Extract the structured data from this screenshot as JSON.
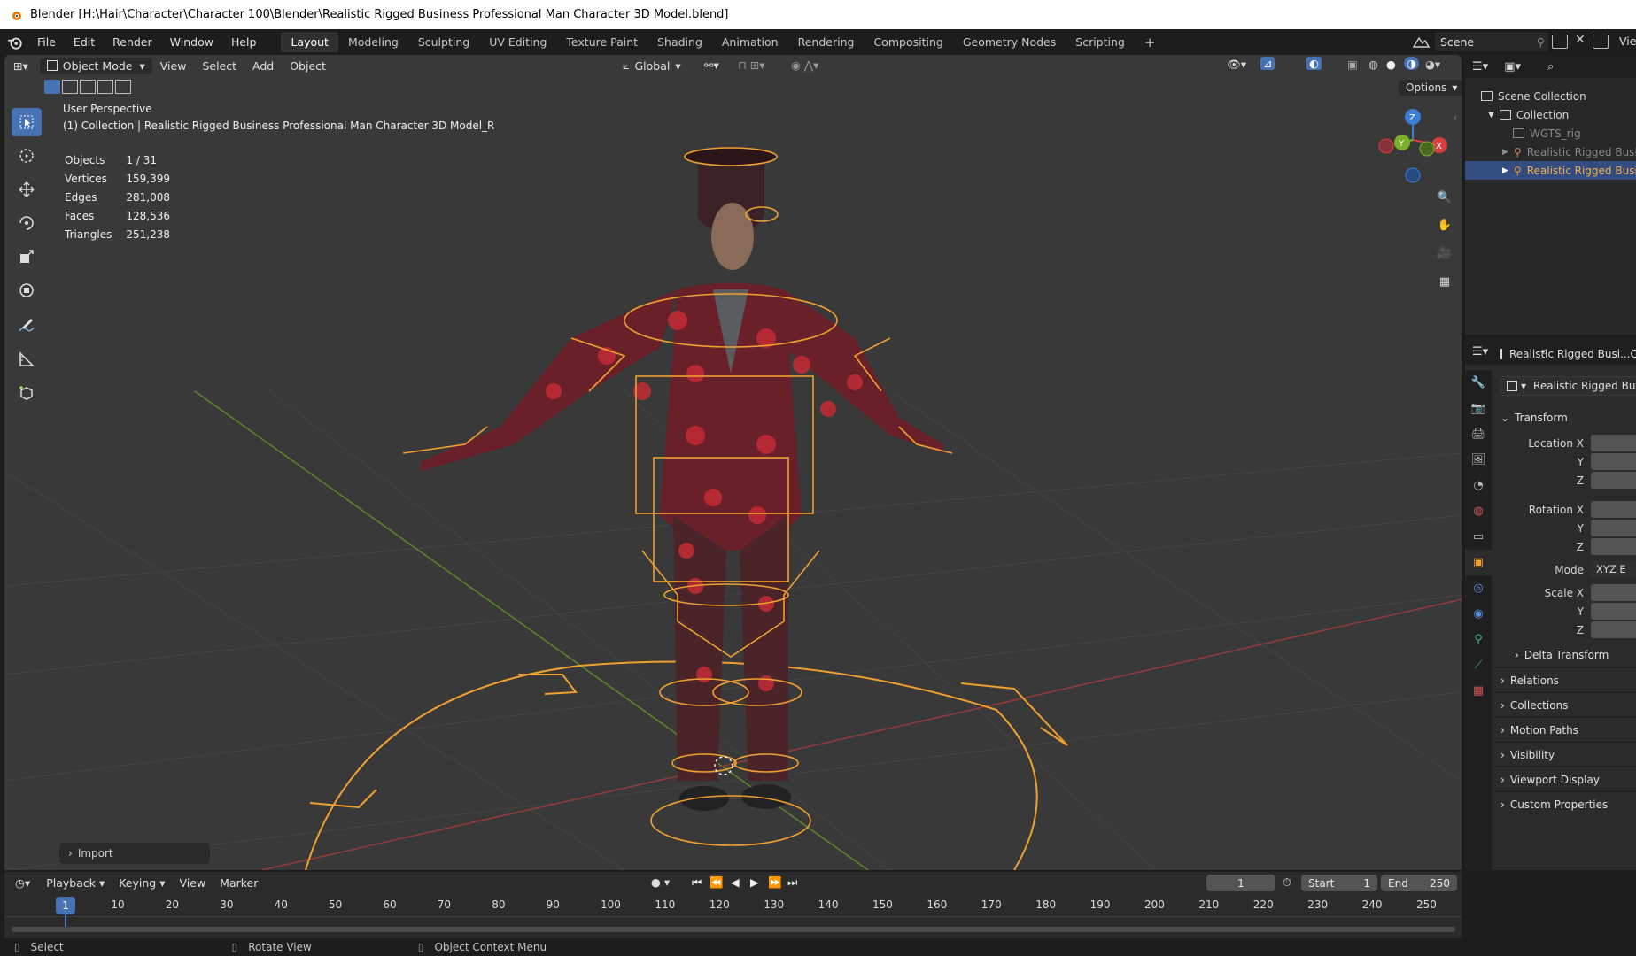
{
  "window": {
    "title": "Blender [H:\\Hair\\Character\\Character 100\\Blender\\Realistic Rigged Business Professional Man Character 3D Model.blend]"
  },
  "menu": [
    "File",
    "Edit",
    "Render",
    "Window",
    "Help"
  ],
  "workspaces": [
    "Layout",
    "Modeling",
    "Sculpting",
    "UV Editing",
    "Texture Paint",
    "Shading",
    "Animation",
    "Rendering",
    "Compositing",
    "Geometry Nodes",
    "Scripting"
  ],
  "active_workspace": "Layout",
  "scene": {
    "name": "Scene",
    "view_layer": "Vie"
  },
  "viewport": {
    "mode": "Object Mode",
    "header_menu": [
      "View",
      "Select",
      "Add",
      "Object"
    ],
    "orientation": "Global",
    "options_label": "Options",
    "perspective": "User Perspective",
    "collection_info": "(1) Collection | Realistic Rigged Business Professional Man Character 3D Model_R",
    "stats": [
      {
        "label": "Objects",
        "value": "1 / 31"
      },
      {
        "label": "Vertices",
        "value": "159,399"
      },
      {
        "label": "Edges",
        "value": "281,008"
      },
      {
        "label": "Faces",
        "value": "128,536"
      },
      {
        "label": "Triangles",
        "value": "251,238"
      }
    ],
    "gizmo": {
      "x": "X",
      "y": "Y",
      "z": "Z"
    },
    "last_operator": "Import"
  },
  "outliner": {
    "rows": [
      {
        "label": "Scene Collection"
      },
      {
        "label": "Collection"
      },
      {
        "label": "WGTS_rig"
      },
      {
        "label": "Realistic Rigged Busi"
      },
      {
        "label": "Realistic Rigged Busi"
      }
    ]
  },
  "properties": {
    "object_name": "Realistic Rigged Busi...Cl",
    "data_name": "Realistic Rigged Bus...",
    "transform_label": "Transform",
    "location": [
      "Location X",
      "Y",
      "Z"
    ],
    "rotation": [
      "Rotation X",
      "Y",
      "Z"
    ],
    "mode_label": "Mode",
    "mode_value": "XYZ E",
    "scale": [
      "Scale X",
      "Y",
      "Z"
    ],
    "delta_transform": "Delta Transform",
    "panels": [
      "Relations",
      "Collections",
      "Motion Paths",
      "Visibility",
      "Viewport Display",
      "Custom Properties"
    ]
  },
  "timeline": {
    "menu": [
      "Playback",
      "Keying",
      "View",
      "Marker"
    ],
    "current_frame": "1",
    "start_label": "Start",
    "start_value": "1",
    "end_label": "End",
    "end_value": "250",
    "ticks": [
      "1",
      "10",
      "20",
      "30",
      "40",
      "50",
      "60",
      "70",
      "80",
      "90",
      "100",
      "110",
      "120",
      "130",
      "140",
      "150",
      "160",
      "170",
      "180",
      "190",
      "200",
      "210",
      "220",
      "230",
      "240",
      "250"
    ]
  },
  "statusbar": {
    "items": [
      "Select",
      "Rotate View",
      "Object Context Menu"
    ]
  },
  "colors": {
    "accent": "#4772b3",
    "selection": "#f0a030",
    "viewport_bg": "#393939"
  }
}
